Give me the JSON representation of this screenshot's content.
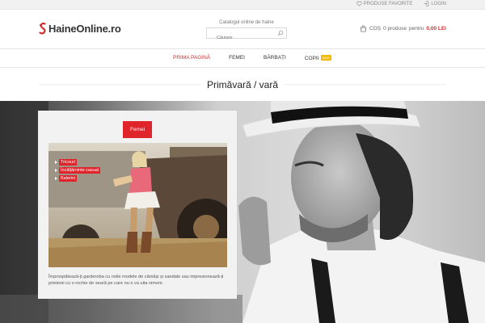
{
  "topbar": {
    "favorites_label": "PRODUSE FAVORITE",
    "login_label": "LOGIN"
  },
  "header": {
    "logo_text": "HaineOnline.ro",
    "search": {
      "caption": "Catalogul online de haine",
      "placeholder": "Căutare"
    },
    "cart": {
      "label": "COȘ",
      "count_text": "0 produse",
      "for_text": "pentru",
      "total": "0,00 LEI"
    }
  },
  "nav": {
    "items": [
      {
        "label": "PRIMA PAGINĂ",
        "active": true
      },
      {
        "label": "FEMEI"
      },
      {
        "label": "BĂRBAȚI"
      },
      {
        "label": "COPII",
        "badge": "NEW"
      }
    ]
  },
  "page": {
    "title": "Primăvară / vară"
  },
  "promo": {
    "tag": "Femei",
    "menu": [
      "Tricouri",
      "Încălțăminte casual",
      "Balerini"
    ],
    "description": "Împrospătează-ți garderoba cu noile modele de cămăși și sandale sau impresionează-ți prietenii cu o rochie de seară pe care nu o va uita nimeni."
  },
  "colors": {
    "accent": "#e0242c",
    "badge": "#f5b800"
  },
  "icons": {
    "favorites": "heart-icon",
    "login": "login-icon",
    "search": "search-icon",
    "cart": "cart-icon"
  }
}
